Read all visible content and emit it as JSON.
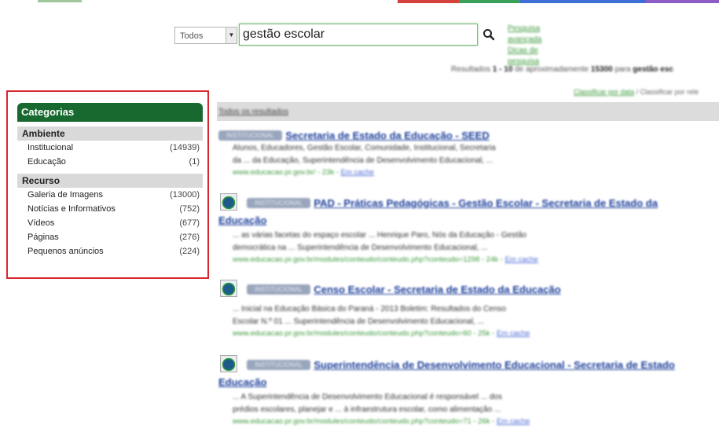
{
  "colors": {
    "brand_green": "#17692f",
    "highlight_red": "#d8262e",
    "link_green": "#3a9a3a",
    "title_blue": "#1d3f9b",
    "top_strip": [
      "#d3413b",
      "#3aa15a",
      "#3d6fd6",
      "#8d5cc4"
    ]
  },
  "search": {
    "scope_value": "Todos",
    "query_value": "gestão escolar",
    "advanced_link": "Pesquisa avançada",
    "tips_link": "Dicas de pesquisa"
  },
  "results_info": {
    "prefix": "Resultados ",
    "range": "1 - 10",
    "middle": " de aproximadamente ",
    "total": "15300",
    "suffix": " para ",
    "term": "gestão esc"
  },
  "sort": {
    "by_date": "Classificar por data",
    "separator": " / ",
    "by_relevance": "Classificar por rele"
  },
  "sidebar": {
    "title": "Categorias",
    "groups": [
      {
        "title": "Ambiente",
        "items": [
          {
            "label": "Institucional",
            "count": "(14939)"
          },
          {
            "label": "Educação",
            "count": "(1)"
          }
        ]
      },
      {
        "title": "Recurso",
        "items": [
          {
            "label": "Galeria de Imagens",
            "count": "(13000)"
          },
          {
            "label": "Notícias e Informativos",
            "count": "(752)"
          },
          {
            "label": "Vídeos",
            "count": "(677)"
          },
          {
            "label": "Páginas",
            "count": "(276)"
          },
          {
            "label": "Pequenos anúncios",
            "count": "(224)"
          }
        ]
      }
    ]
  },
  "all_results_label": "Todos os resultados",
  "results": [
    {
      "badge": "INSTITUCIONAL",
      "title_line1": "Secretaria de Estado da Educação - SEED",
      "title_line2": "",
      "snippet1": "Alunos, Educadores, Gestão Escolar, Comunidade, Institucional, Secretaria",
      "snippet2": "da ... da Educação, Superintendência de Desenvolvimento Educacional, ...",
      "url": "www.educacao.pr.gov.br/ - 23k - ",
      "cache": "Em cache"
    },
    {
      "badge": "INSTITUCIONAL",
      "title_line1": "PAD - Práticas Pedagógicas - Gestão Escolar - Secretaria de Estado da",
      "title_line2": "Educação",
      "snippet1": "... as várias facetas do espaço escolar ... Henrique Paro, Nós da Educação - Gestão",
      "snippet2": "democrática na ... Superintendência de Desenvolvimento Educacional, ...",
      "url": "www.educacao.pr.gov.br/modules/conteudo/conteudo.php?conteudo=1298 - 24k - ",
      "cache": "Em cache"
    },
    {
      "badge": "INSTITUCIONAL",
      "title_line1": "Censo Escolar - Secretaria de Estado da Educação",
      "title_line2": "",
      "snippet1": "... Inicial na Educação Básica do Paraná - 2013 Boletim: Resultados do Censo",
      "snippet2": "Escolar N.º 01 ... Superintendência de Desenvolvimento Educacional, ...",
      "url": "www.educacao.pr.gov.br/modules/conteudo/conteudo.php?conteudo=60 - 25k - ",
      "cache": "Em cache"
    },
    {
      "badge": "INSTITUCIONAL",
      "title_line1": "Superintendência de Desenvolvimento Educacional - Secretaria de Estado",
      "title_line2": "Educação",
      "snippet1": "... A Superintendência de Desenvolvimento Educacional é responsável ... dos",
      "snippet2": "prédios escolares, planejar e ... à infraestrutura escolar, como alimentação ...",
      "url": "www.educacao.pr.gov.br/modules/conteudo/conteudo.php?conteudo=71 - 26k - ",
      "cache": "Em cache"
    }
  ]
}
